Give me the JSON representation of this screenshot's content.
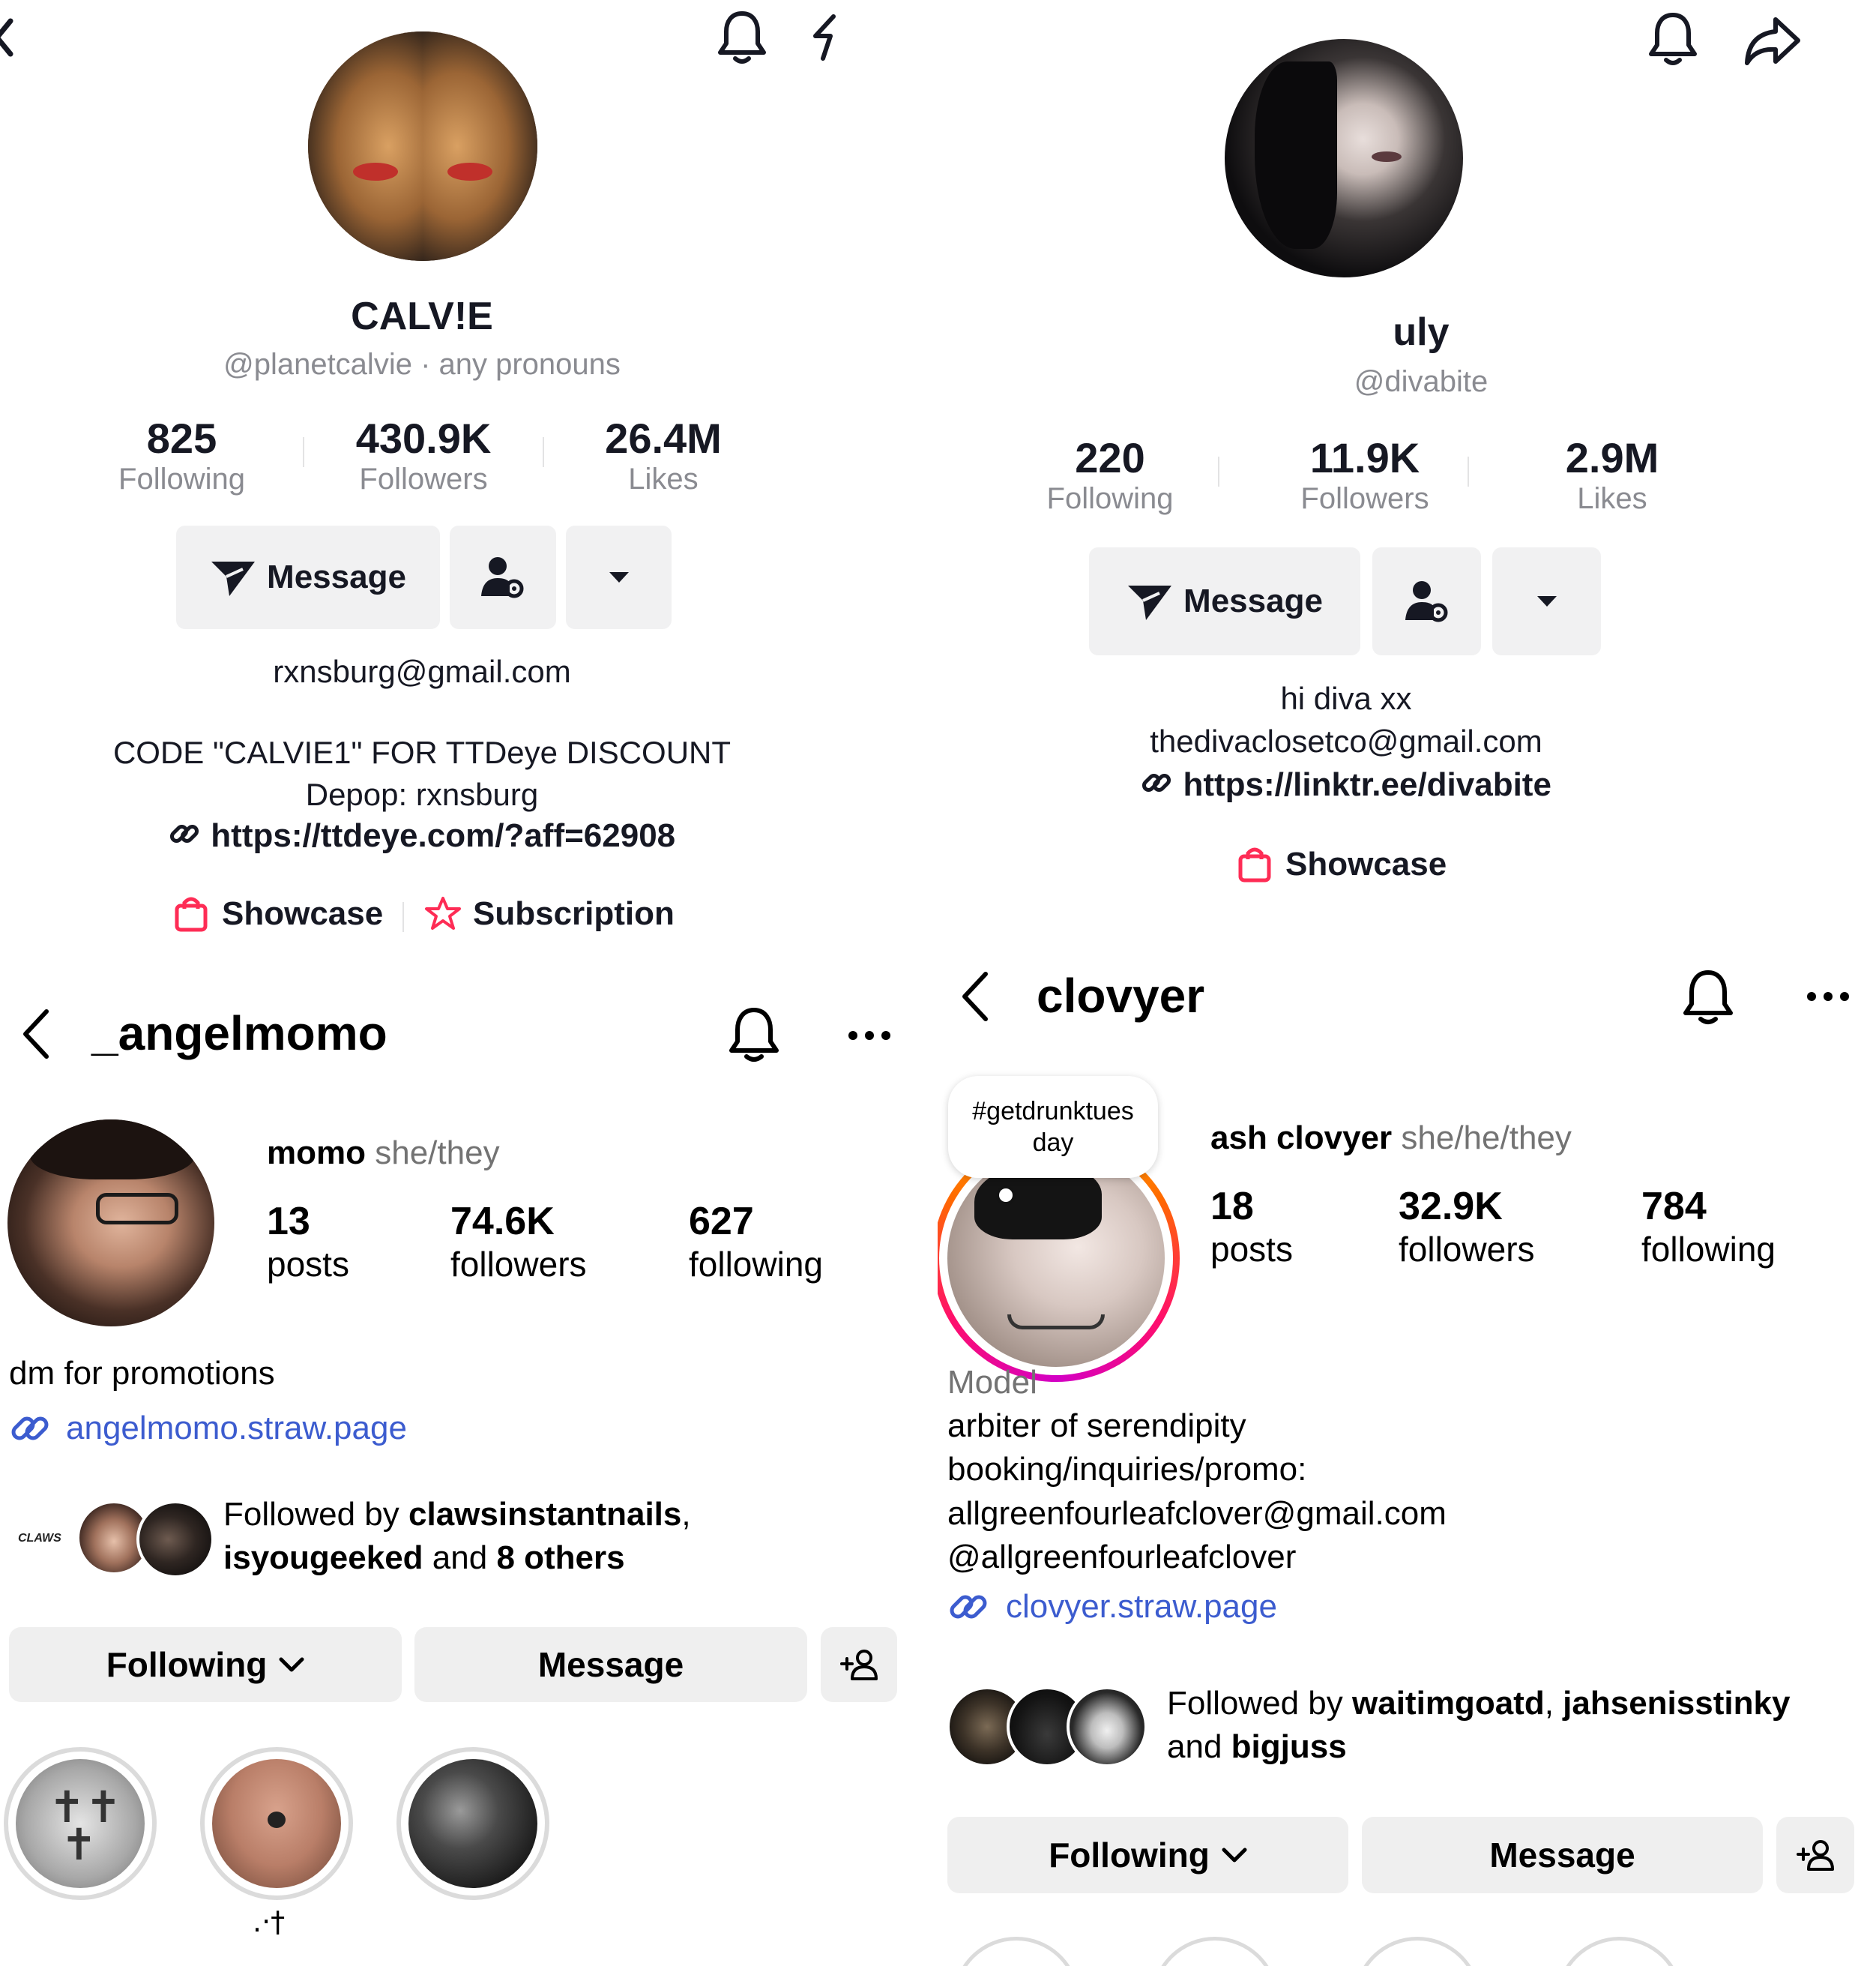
{
  "tiktok_calvie": {
    "display_name": "CALV!E",
    "handle": "@planetcalvie · any pronouns",
    "stats": [
      {
        "value": "825",
        "label": "Following"
      },
      {
        "value": "430.9K",
        "label": "Followers"
      },
      {
        "value": "26.4M",
        "label": "Likes"
      }
    ],
    "message_label": "Message",
    "bio_lines": [
      "rxnsburg@gmail.com",
      "CODE \"CALVIE1\" FOR TTDeye DISCOUNT",
      "Depop: rxnsburg"
    ],
    "link": "https://ttdeye.com/?aff=62908",
    "tools": [
      "Showcase",
      "Subscription"
    ]
  },
  "tiktok_uly": {
    "display_name": "uly",
    "handle": "@divabite",
    "stats": [
      {
        "value": "220",
        "label": "Following"
      },
      {
        "value": "11.9K",
        "label": "Followers"
      },
      {
        "value": "2.9M",
        "label": "Likes"
      }
    ],
    "message_label": "Message",
    "bio_lines": [
      "hi diva xx",
      "thedivaclosetco@gmail.com"
    ],
    "link": "https://linktr.ee/divabite",
    "tools": [
      "Showcase"
    ]
  },
  "ig_angelmomo": {
    "username": "_angelmomo",
    "name": "momo",
    "pronouns": "she/they",
    "stats": [
      {
        "value": "13",
        "label": "posts"
      },
      {
        "value": "74.6K",
        "label": "followers"
      },
      {
        "value": "627",
        "label": "following"
      }
    ],
    "bio": "dm for promotions",
    "link": "angelmomo.straw.page",
    "followed_by": {
      "prefix": "Followed by ",
      "name1": "clawsinstantnails",
      "sep": ",",
      "name2": "isyougeeked",
      "mid": " and ",
      "others": "8 others"
    },
    "buttons": {
      "following": "Following",
      "message": "Message"
    },
    "highlight_caption": ".·†",
    "follower_logo_text": "CLAWS"
  },
  "ig_clovyer": {
    "username": "clovyer",
    "note": "#getdrunktuesday",
    "name": "ash clovyer",
    "pronouns": "she/he/they",
    "stats": [
      {
        "value": "18",
        "label": "posts"
      },
      {
        "value": "32.9K",
        "label": "followers"
      },
      {
        "value": "784",
        "label": "following"
      }
    ],
    "category": "Model",
    "bio_lines": [
      "arbiter of serendipity",
      "booking/inquiries/promo:",
      "allgreenfourleafclover@gmail.com",
      "@allgreenfourleafclover"
    ],
    "link": "clovyer.straw.page",
    "followed_by": {
      "prefix": "Followed by ",
      "name1": "waitimgoatd",
      "sep": ", ",
      "name2": "jahsenisstinky",
      "mid": "and ",
      "name3": "bigjuss"
    },
    "buttons": {
      "following": "Following",
      "message": "Message"
    }
  },
  "colors": {
    "tiktok_accent": "#fe2c55",
    "ig_link": "#3c5ccf",
    "button_bg": "#efefef"
  }
}
